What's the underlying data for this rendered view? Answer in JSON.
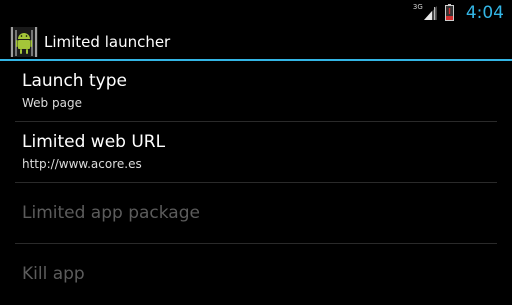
{
  "status_bar": {
    "network_type": "3G",
    "time": "4:04",
    "signal_icon": "signal-icon",
    "battery_icon": "battery-low-icon",
    "clock_color": "#33b5e5"
  },
  "action_bar": {
    "title": "Limited launcher",
    "app_icon": "android-app-icon",
    "divider_color": "#33b5e5"
  },
  "preferences": [
    {
      "title": "Launch type",
      "summary": "Web page",
      "enabled": true
    },
    {
      "title": "Limited web URL",
      "summary": "http://www.acore.es",
      "enabled": true
    },
    {
      "title": "Limited app package",
      "summary": "",
      "enabled": false
    },
    {
      "title": "Kill app",
      "summary": "",
      "enabled": false
    }
  ]
}
